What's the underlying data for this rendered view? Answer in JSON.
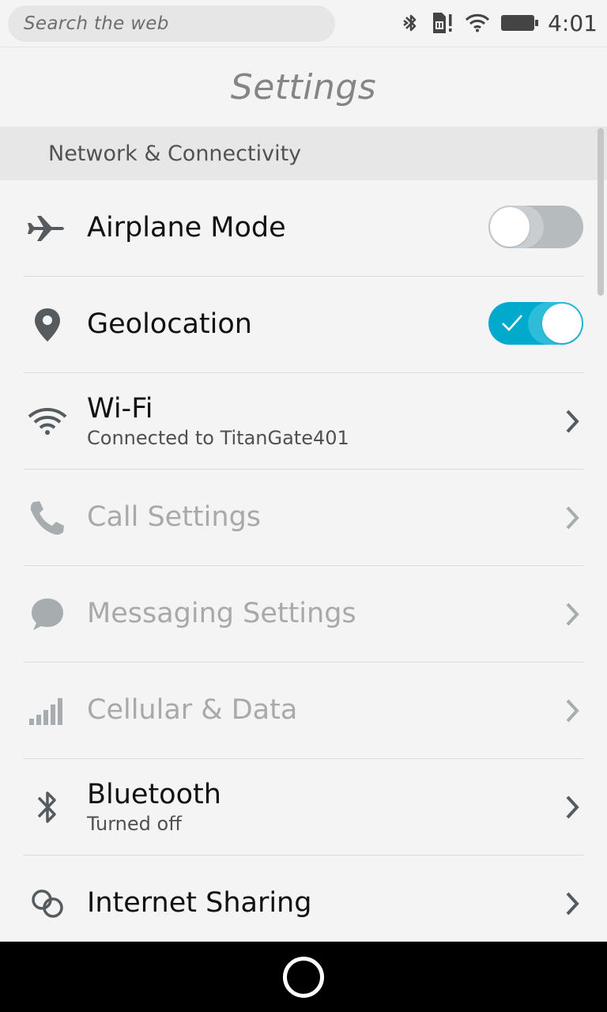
{
  "statusbar": {
    "search_placeholder": "Search the web",
    "time": "4:01",
    "icons": [
      "bluetooth-icon",
      "sim-alert-icon",
      "wifi-icon",
      "battery-icon"
    ]
  },
  "header": {
    "title": "Settings"
  },
  "section": {
    "title": "Network & Connectivity"
  },
  "colors": {
    "accent": "#00aacc",
    "toggle_off": "#b6bbbd",
    "text_disabled": "#a9a9a9"
  },
  "rows": [
    {
      "label": "Airplane Mode",
      "icon": "airplane-icon",
      "control": "toggle",
      "state": "off"
    },
    {
      "label": "Geolocation",
      "icon": "location-pin-icon",
      "control": "toggle",
      "state": "on"
    },
    {
      "label": "Wi-Fi",
      "sub": "Connected to TitanGate401",
      "icon": "wifi-icon",
      "control": "chevron"
    },
    {
      "label": "Call Settings",
      "icon": "phone-icon",
      "control": "chevron",
      "disabled": true
    },
    {
      "label": "Messaging Settings",
      "icon": "chat-bubble-icon",
      "control": "chevron",
      "disabled": true
    },
    {
      "label": "Cellular & Data",
      "icon": "signal-bars-icon",
      "control": "chevron",
      "disabled": true
    },
    {
      "label": "Bluetooth",
      "sub": "Turned off",
      "icon": "bluetooth-icon",
      "control": "chevron"
    },
    {
      "label": "Internet Sharing",
      "icon": "internet-sharing-icon",
      "control": "chevron"
    }
  ]
}
